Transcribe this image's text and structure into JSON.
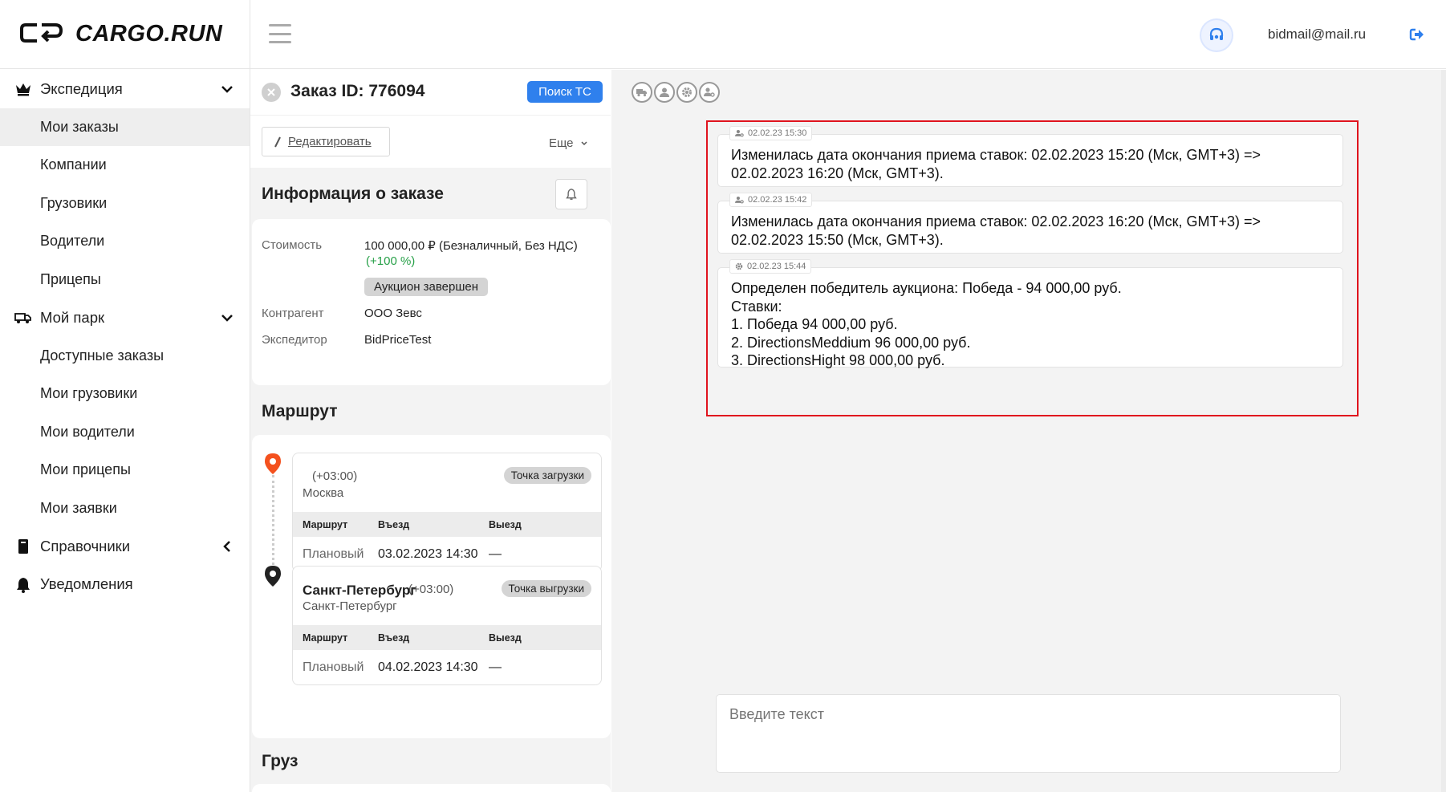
{
  "header": {
    "logo_text": "CARGO.RUN",
    "user_email": "bidmail@mail.ru",
    "support_icon": "headset-icon",
    "logout_icon": "logout-icon",
    "accent_color": "#2f80ed"
  },
  "sidebar": {
    "groups": [
      {
        "label": "Экспедиция",
        "icon": "crown-icon",
        "caret": "down"
      },
      {
        "label": "Мой парк",
        "icon": "truck-icon",
        "caret": "down"
      },
      {
        "label": "Справочники",
        "icon": "book-icon",
        "caret": "left"
      },
      {
        "label": "Уведомления",
        "icon": "bell-icon"
      }
    ],
    "expedition_items": [
      "Мои заказы",
      "Компании",
      "Грузовики",
      "Водители",
      "Прицепы"
    ],
    "park_items": [
      "Доступные заказы",
      "Мои грузовики",
      "Мои водители",
      "Мои прицепы",
      "Мои заявки"
    ],
    "active_item": "Мои заказы"
  },
  "order": {
    "title": "Заказ ID: 776094",
    "search_button": "Поиск ТС",
    "edit_button": "Редактировать",
    "more_button": "Еще",
    "info_title": "Информация о заказе",
    "route_title": "Маршрут",
    "cargo_title": "Груз",
    "info": {
      "cost_label": "Стоимость",
      "cost_value": "100 000,00 ₽ (Безналичный, Без НДС)",
      "cost_change": "(+100 %)",
      "status_badge": "Аукцион завершен",
      "counterparty_label": "Контрагент",
      "counterparty_value": "ООО Зевс",
      "forwarder_label": "Экспедитор",
      "forwarder_value": "BidPriceTest"
    },
    "route": {
      "columns": [
        "Маршрут",
        "Въезд",
        "Выезд"
      ],
      "points": [
        {
          "city": "",
          "tz": "(+03:00)",
          "sub": "Москва",
          "badge": "Точка загрузки",
          "row_type": "Плановый",
          "in": "03.02.2023 14:30",
          "out": "—",
          "pin_color": "#f4511e"
        },
        {
          "city": "Санкт-Петербург",
          "tz": "(+03:00)",
          "sub": "Санкт-Петербург",
          "badge": "Точка выгрузки",
          "row_type": "Плановый",
          "in": "04.02.2023 14:30",
          "out": "—",
          "pin_color": "#222222"
        }
      ]
    }
  },
  "chat": {
    "filter_icons": [
      "truck-filter-icon",
      "user-filter-icon",
      "gear-filter-icon",
      "user-settings-filter-icon"
    ],
    "messages": [
      {
        "time": "02.02.23 15:30",
        "icon": "user-gear-icon",
        "text": "Изменилась дата окончания приема ставок: 02.02.2023 15:20 (Мск, GMT+3) =>\n02.02.2023 16:20 (Мск, GMT+3)."
      },
      {
        "time": "02.02.23 15:42",
        "icon": "user-gear-icon",
        "text": "Изменилась дата окончания приема ставок: 02.02.2023 16:20 (Мск, GMT+3) =>\n02.02.2023 15:50 (Мск, GMT+3)."
      },
      {
        "time": "02.02.23 15:44",
        "icon": "gear-icon",
        "text": "Определен победитель аукциона: Победа - 94 000,00 руб.\nСтавки:\n1. Победа 94 000,00 руб.\n2. DirectionsMeddium 96 000,00 руб.\n3. DirectionsHight 98 000,00 руб."
      }
    ],
    "input_placeholder": "Введите текст",
    "highlight_color": "#e0141e"
  }
}
